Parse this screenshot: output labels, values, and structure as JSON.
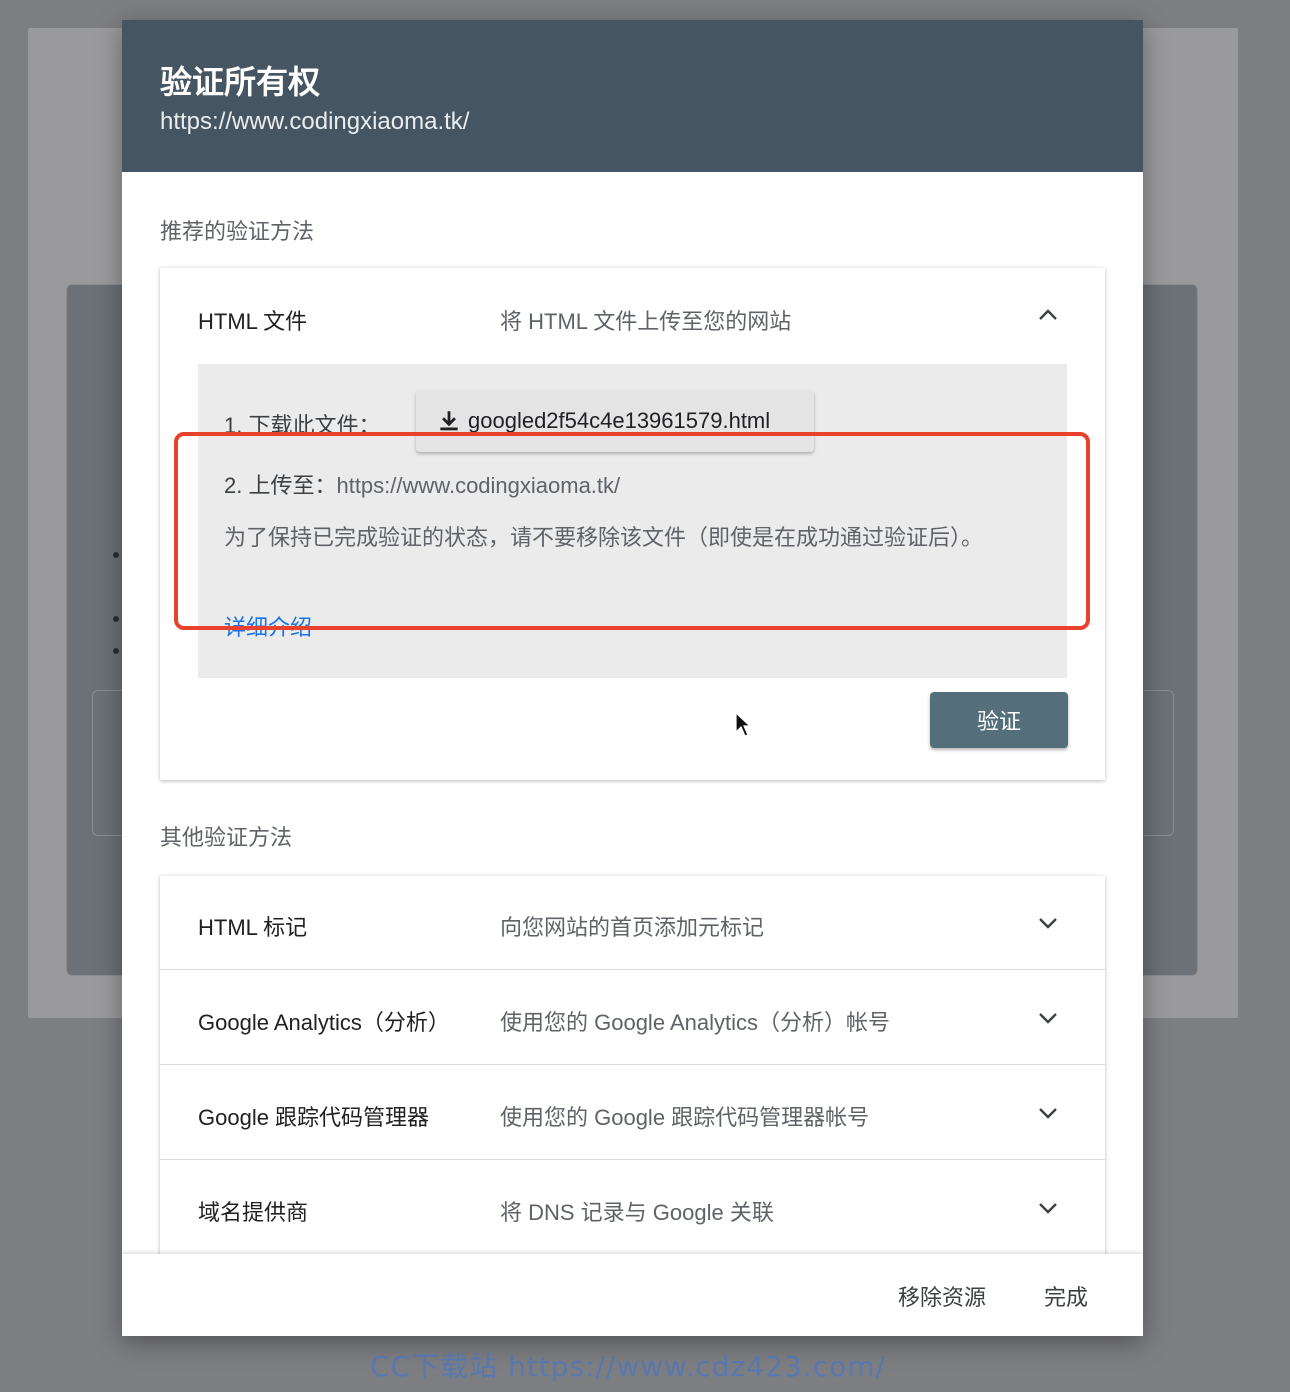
{
  "dialog": {
    "title": "验证所有权",
    "subtitle": "https://www.codingxiaoma.tk/"
  },
  "recommended": {
    "section_label": "推荐的验证方法",
    "method": {
      "title": "HTML 文件",
      "description": "将 HTML 文件上传至您的网站",
      "chevron": "chevron-up-icon"
    },
    "step1_label": "1. 下载此文件：",
    "download_icon": "download-icon",
    "download_file": "googled2f54c4e13961579.html",
    "step2_label": "2. 上传至：",
    "step2_url": "https://www.codingxiaoma.tk/",
    "note": "为了保持已完成验证的状态，请不要移除该文件（即使是在成功通过验证后）。",
    "learn_more": "详细介绍",
    "verify_button": "验证"
  },
  "other": {
    "section_label": "其他验证方法",
    "methods": [
      {
        "title": "HTML 标记",
        "description": "向您网站的首页添加元标记"
      },
      {
        "title": "Google Analytics（分析）",
        "description": "使用您的 Google Analytics（分析）帐号"
      },
      {
        "title": "Google 跟踪代码管理器",
        "description": "使用您的 Google 跟踪代码管理器帐号"
      },
      {
        "title": "域名提供商",
        "description": "将 DNS 记录与 Google 关联"
      }
    ]
  },
  "footer": {
    "remove_button": "移除资源",
    "done_button": "完成"
  },
  "watermark": "CC下载站 https://www.cdz423.com/",
  "colors": {
    "header_bg": "#455561",
    "verify_bg": "#546e7a",
    "link": "#1a73e8",
    "highlight": "#e8412c"
  }
}
